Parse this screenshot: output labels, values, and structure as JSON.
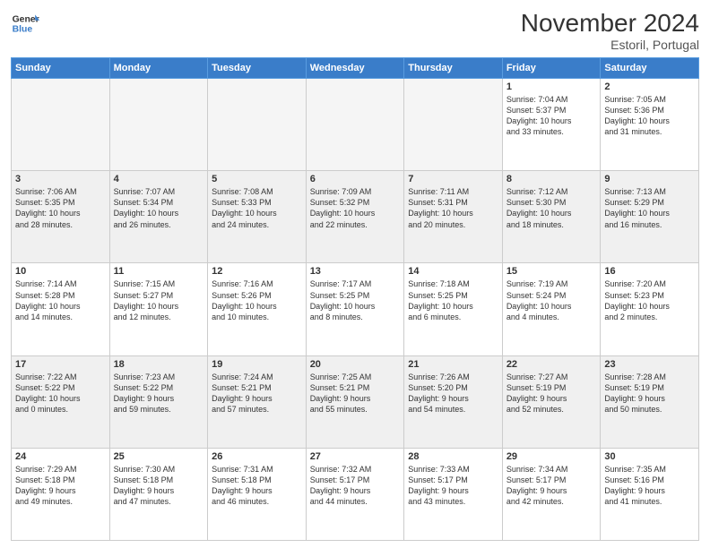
{
  "header": {
    "logo_line1": "General",
    "logo_line2": "Blue",
    "month": "November 2024",
    "location": "Estoril, Portugal"
  },
  "weekdays": [
    "Sunday",
    "Monday",
    "Tuesday",
    "Wednesday",
    "Thursday",
    "Friday",
    "Saturday"
  ],
  "weeks": [
    [
      {
        "day": "",
        "info": ""
      },
      {
        "day": "",
        "info": ""
      },
      {
        "day": "",
        "info": ""
      },
      {
        "day": "",
        "info": ""
      },
      {
        "day": "",
        "info": ""
      },
      {
        "day": "1",
        "info": "Sunrise: 7:04 AM\nSunset: 5:37 PM\nDaylight: 10 hours\nand 33 minutes."
      },
      {
        "day": "2",
        "info": "Sunrise: 7:05 AM\nSunset: 5:36 PM\nDaylight: 10 hours\nand 31 minutes."
      }
    ],
    [
      {
        "day": "3",
        "info": "Sunrise: 7:06 AM\nSunset: 5:35 PM\nDaylight: 10 hours\nand 28 minutes."
      },
      {
        "day": "4",
        "info": "Sunrise: 7:07 AM\nSunset: 5:34 PM\nDaylight: 10 hours\nand 26 minutes."
      },
      {
        "day": "5",
        "info": "Sunrise: 7:08 AM\nSunset: 5:33 PM\nDaylight: 10 hours\nand 24 minutes."
      },
      {
        "day": "6",
        "info": "Sunrise: 7:09 AM\nSunset: 5:32 PM\nDaylight: 10 hours\nand 22 minutes."
      },
      {
        "day": "7",
        "info": "Sunrise: 7:11 AM\nSunset: 5:31 PM\nDaylight: 10 hours\nand 20 minutes."
      },
      {
        "day": "8",
        "info": "Sunrise: 7:12 AM\nSunset: 5:30 PM\nDaylight: 10 hours\nand 18 minutes."
      },
      {
        "day": "9",
        "info": "Sunrise: 7:13 AM\nSunset: 5:29 PM\nDaylight: 10 hours\nand 16 minutes."
      }
    ],
    [
      {
        "day": "10",
        "info": "Sunrise: 7:14 AM\nSunset: 5:28 PM\nDaylight: 10 hours\nand 14 minutes."
      },
      {
        "day": "11",
        "info": "Sunrise: 7:15 AM\nSunset: 5:27 PM\nDaylight: 10 hours\nand 12 minutes."
      },
      {
        "day": "12",
        "info": "Sunrise: 7:16 AM\nSunset: 5:26 PM\nDaylight: 10 hours\nand 10 minutes."
      },
      {
        "day": "13",
        "info": "Sunrise: 7:17 AM\nSunset: 5:25 PM\nDaylight: 10 hours\nand 8 minutes."
      },
      {
        "day": "14",
        "info": "Sunrise: 7:18 AM\nSunset: 5:25 PM\nDaylight: 10 hours\nand 6 minutes."
      },
      {
        "day": "15",
        "info": "Sunrise: 7:19 AM\nSunset: 5:24 PM\nDaylight: 10 hours\nand 4 minutes."
      },
      {
        "day": "16",
        "info": "Sunrise: 7:20 AM\nSunset: 5:23 PM\nDaylight: 10 hours\nand 2 minutes."
      }
    ],
    [
      {
        "day": "17",
        "info": "Sunrise: 7:22 AM\nSunset: 5:22 PM\nDaylight: 10 hours\nand 0 minutes."
      },
      {
        "day": "18",
        "info": "Sunrise: 7:23 AM\nSunset: 5:22 PM\nDaylight: 9 hours\nand 59 minutes."
      },
      {
        "day": "19",
        "info": "Sunrise: 7:24 AM\nSunset: 5:21 PM\nDaylight: 9 hours\nand 57 minutes."
      },
      {
        "day": "20",
        "info": "Sunrise: 7:25 AM\nSunset: 5:21 PM\nDaylight: 9 hours\nand 55 minutes."
      },
      {
        "day": "21",
        "info": "Sunrise: 7:26 AM\nSunset: 5:20 PM\nDaylight: 9 hours\nand 54 minutes."
      },
      {
        "day": "22",
        "info": "Sunrise: 7:27 AM\nSunset: 5:19 PM\nDaylight: 9 hours\nand 52 minutes."
      },
      {
        "day": "23",
        "info": "Sunrise: 7:28 AM\nSunset: 5:19 PM\nDaylight: 9 hours\nand 50 minutes."
      }
    ],
    [
      {
        "day": "24",
        "info": "Sunrise: 7:29 AM\nSunset: 5:18 PM\nDaylight: 9 hours\nand 49 minutes."
      },
      {
        "day": "25",
        "info": "Sunrise: 7:30 AM\nSunset: 5:18 PM\nDaylight: 9 hours\nand 47 minutes."
      },
      {
        "day": "26",
        "info": "Sunrise: 7:31 AM\nSunset: 5:18 PM\nDaylight: 9 hours\nand 46 minutes."
      },
      {
        "day": "27",
        "info": "Sunrise: 7:32 AM\nSunset: 5:17 PM\nDaylight: 9 hours\nand 44 minutes."
      },
      {
        "day": "28",
        "info": "Sunrise: 7:33 AM\nSunset: 5:17 PM\nDaylight: 9 hours\nand 43 minutes."
      },
      {
        "day": "29",
        "info": "Sunrise: 7:34 AM\nSunset: 5:17 PM\nDaylight: 9 hours\nand 42 minutes."
      },
      {
        "day": "30",
        "info": "Sunrise: 7:35 AM\nSunset: 5:16 PM\nDaylight: 9 hours\nand 41 minutes."
      }
    ]
  ]
}
